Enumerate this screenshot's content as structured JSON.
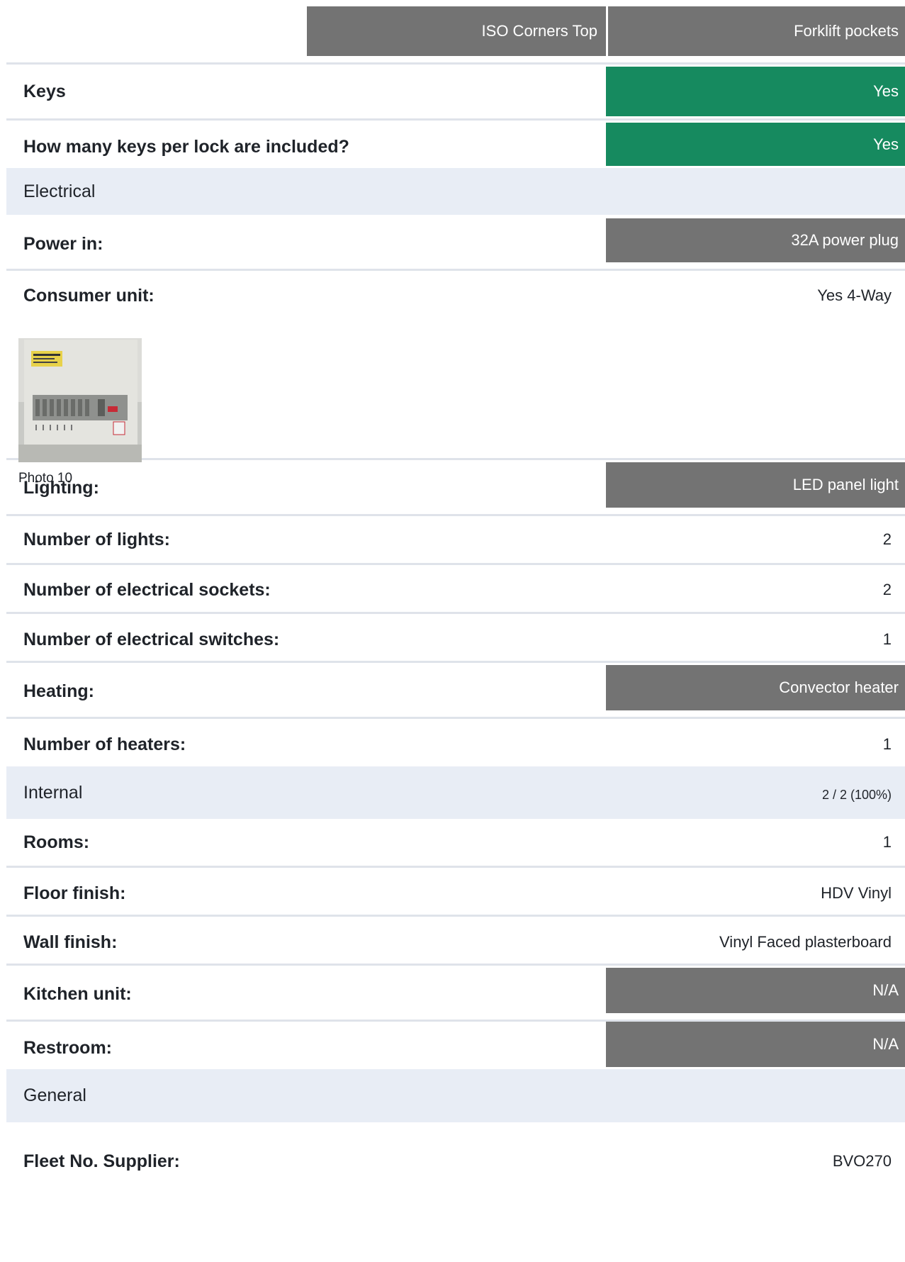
{
  "header": {
    "col1": "ISO Corners Top",
    "col2": "Forklift pockets"
  },
  "rows": {
    "keys": {
      "label": "Keys",
      "value": "Yes"
    },
    "keys_per_lock": {
      "label": "How many keys per lock are included?",
      "value": "Yes"
    },
    "power_in": {
      "label": "Power in:",
      "value": "32A power plug"
    },
    "consumer_unit": {
      "label": "Consumer unit:",
      "value": "Yes 4-Way",
      "photo_caption": "Photo 10"
    },
    "lighting": {
      "label": "Lighting:",
      "value": "LED panel light"
    },
    "num_lights": {
      "label": "Number of lights:",
      "value": "2"
    },
    "num_sockets": {
      "label": "Number of electrical sockets:",
      "value": "2"
    },
    "num_switches": {
      "label": "Number of electrical switches:",
      "value": "1"
    },
    "heating": {
      "label": "Heating:",
      "value": "Convector heater"
    },
    "num_heaters": {
      "label": "Number of heaters:",
      "value": "1"
    },
    "rooms": {
      "label": "Rooms:",
      "value": "1"
    },
    "floor_finish": {
      "label": "Floor finish:",
      "value": "HDV Vinyl"
    },
    "wall_finish": {
      "label": "Wall finish:",
      "value": "Vinyl Faced plasterboard"
    },
    "kitchen_unit": {
      "label": "Kitchen unit:",
      "value": "N/A"
    },
    "restroom": {
      "label": "Restroom:",
      "value": "N/A"
    },
    "fleet_no": {
      "label": "Fleet No. Supplier:",
      "value": "BVO270"
    }
  },
  "sections": {
    "electrical": {
      "title": "Electrical"
    },
    "internal": {
      "title": "Internal",
      "progress": "2 / 2 (100%)"
    },
    "general": {
      "title": "General"
    }
  },
  "colors": {
    "value_gray": "#737373",
    "value_green": "#168a5f",
    "section_bg": "#e8edf5"
  }
}
